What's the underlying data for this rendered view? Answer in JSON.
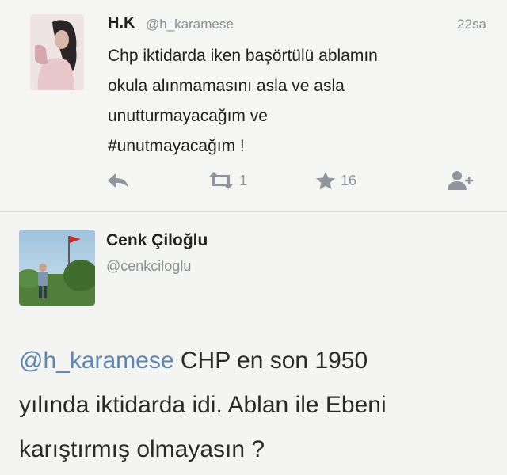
{
  "tweet1": {
    "name": "H.K",
    "handle": "@h_karamese",
    "time": "22sa",
    "text_lines": [
      "Chp iktidarda iken başörtülü ablamın",
      "okula alınmamasını asla ve asla",
      "unutturmayacağım ve",
      "#unutmayacağım !"
    ],
    "actions": {
      "reply_icon": "reply-icon",
      "retweet_icon": "retweet-icon",
      "retweet_count": "1",
      "favorite_icon": "star-icon",
      "favorite_count": "16",
      "follow_icon": "follow-user-icon"
    }
  },
  "tweet2": {
    "name": "Cenk Çiloğlu",
    "handle": "@cenkciloglu",
    "mention": "@h_karamese",
    "text_lines": [
      " CHP en son 1950",
      "yılında iktidarda idi. Ablan ile Ebeni",
      "karıştırmış olmayasın ?"
    ]
  },
  "colors": {
    "mention": "#5d86b3",
    "meta": "#8a8f94",
    "icon": "#8f959b"
  }
}
